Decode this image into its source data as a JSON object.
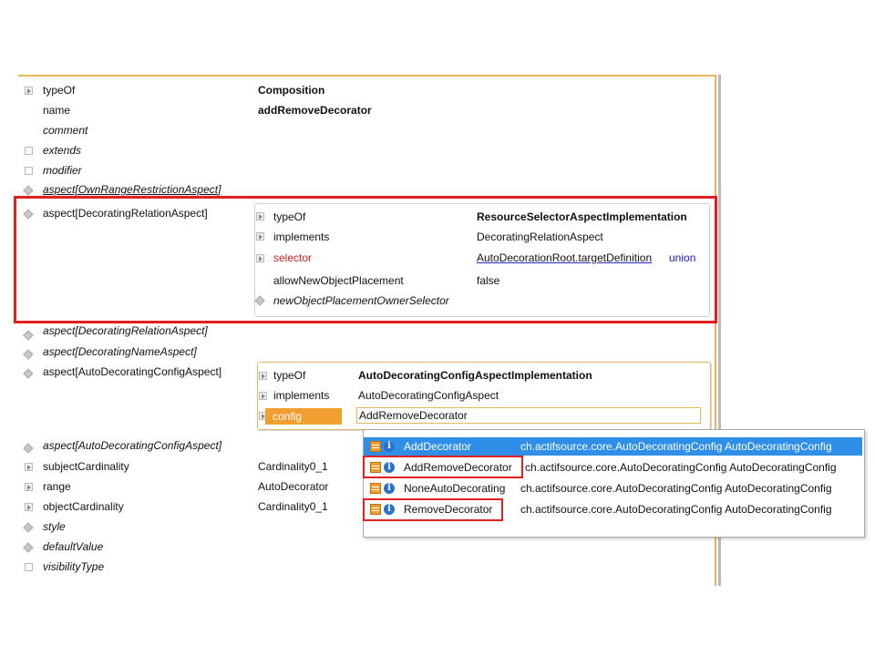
{
  "editor": {
    "rows": [
      {
        "label": "typeOf",
        "value": "Composition"
      },
      {
        "label": "name",
        "value": "addRemoveDecorator"
      },
      {
        "label": "comment"
      },
      {
        "label": "extends"
      },
      {
        "label": "modifier"
      },
      {
        "label": "aspect[OwnRangeRestrictionAspect]"
      },
      {
        "label": "aspect[DecoratingRelationAspect]"
      },
      {
        "label": "aspect[DecoratingRelationAspect]"
      },
      {
        "label": "aspect[DecoratingNameAspect]"
      },
      {
        "label": "aspect[AutoDecoratingConfigAspect]"
      },
      {
        "label": "aspect[AutoDecoratingConfigAspect]"
      },
      {
        "label": "subjectCardinality",
        "value": "Cardinality0_1"
      },
      {
        "label": "range",
        "value": "AutoDecorator"
      },
      {
        "label": "objectCardinality",
        "value": "Cardinality0_1"
      },
      {
        "label": "style"
      },
      {
        "label": "defaultValue"
      },
      {
        "label": "visibilityType"
      }
    ],
    "decorating_panel": {
      "rows": [
        {
          "label": "typeOf",
          "value": "ResourceSelectorAspectImplementation"
        },
        {
          "label": "implements",
          "value": "DecoratingRelationAspect"
        },
        {
          "label": "selector",
          "value": "AutoDecorationRoot.targetDefinition",
          "suffix": "union"
        },
        {
          "label": "allowNewObjectPlacement",
          "value": "false"
        },
        {
          "label": "newObjectPlacementOwnerSelector"
        }
      ]
    },
    "config_panel": {
      "rows": [
        {
          "label": "typeOf",
          "value": "AutoDecoratingConfigAspectImplementation"
        },
        {
          "label": "implements",
          "value": "AutoDecoratingConfigAspect"
        },
        {
          "label": "config",
          "value": "AddRemoveDecorator"
        }
      ]
    }
  },
  "popup": {
    "items": [
      {
        "name": "AddDecorator",
        "detail": "ch.actifsource.core.AutoDecoratingConfig AutoDecoratingConfig"
      },
      {
        "name": "AddRemoveDecorator",
        "detail": "ch.actifsource.core.AutoDecoratingConfig AutoDecoratingConfig"
      },
      {
        "name": "NoneAutoDecorating",
        "detail": "ch.actifsource.core.AutoDecoratingConfig AutoDecoratingConfig"
      },
      {
        "name": "RemoveDecorator",
        "detail": "ch.actifsource.core.AutoDecoratingConfig AutoDecoratingConfig"
      }
    ]
  },
  "colors": {
    "accent": "#f0a030",
    "highlight_box": "#e02020",
    "selection": "#2f8fe8",
    "link_blue": "#1a1ad0"
  }
}
